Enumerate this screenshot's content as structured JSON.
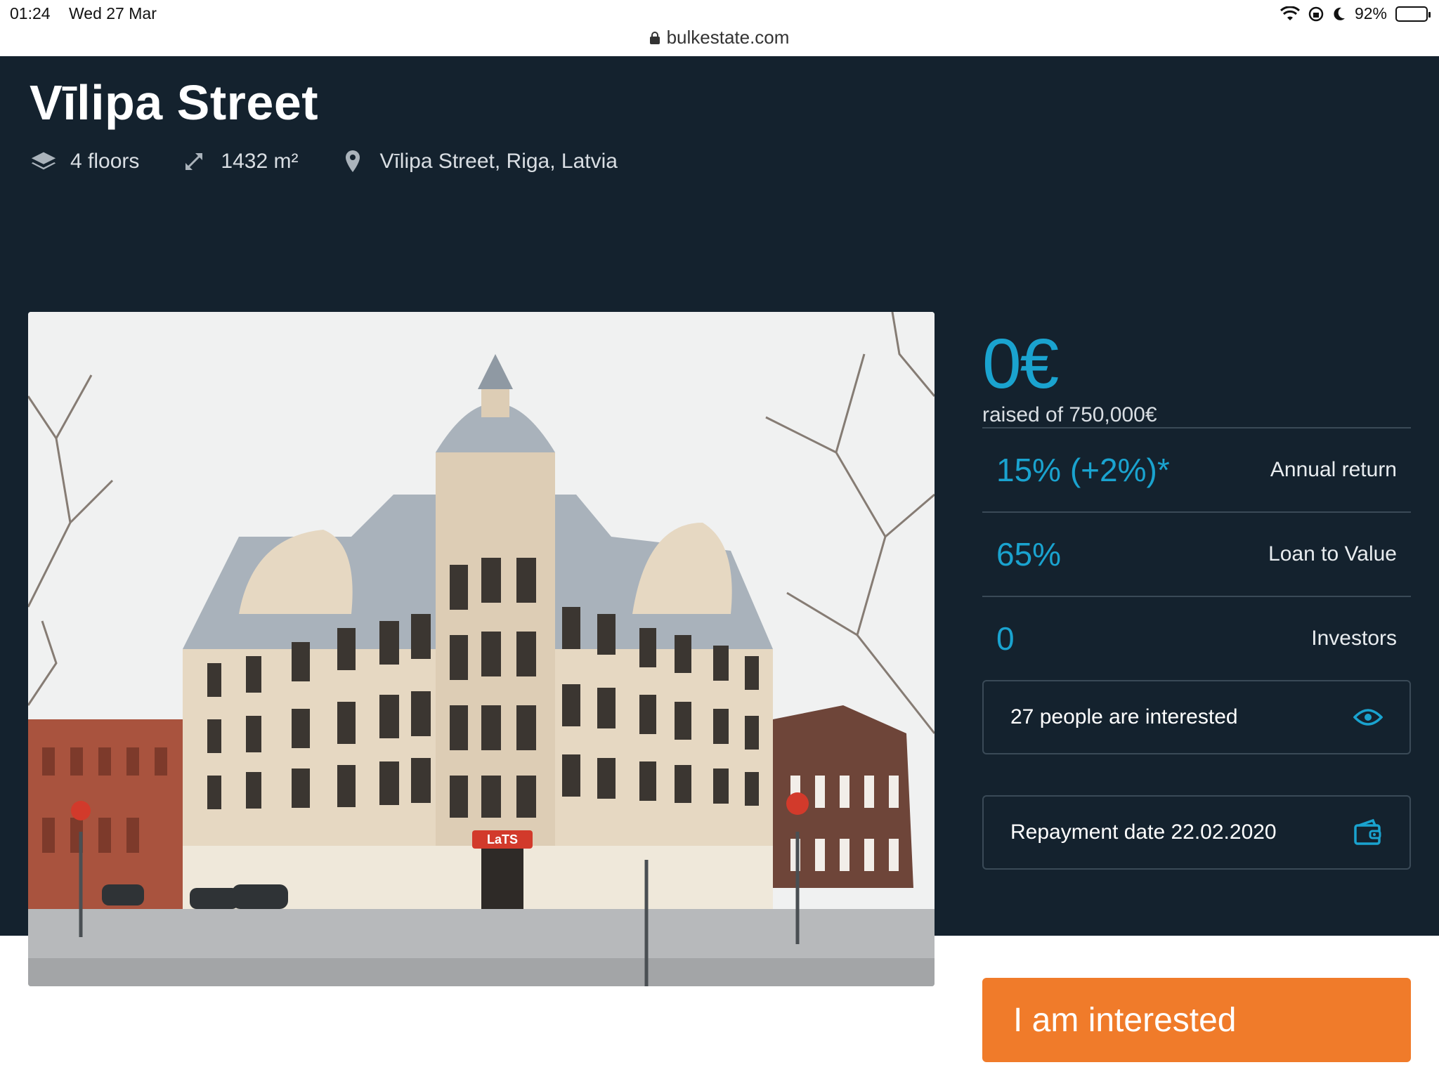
{
  "status_bar": {
    "time": "01:24",
    "date": "Wed 27 Mar",
    "battery": "92%",
    "battery_level": 0.92
  },
  "browser": {
    "url": "bulkestate.com"
  },
  "property": {
    "title": "Vīlipa Street",
    "floors": "4 floors",
    "area": "1432 m²",
    "location": "Vīlipa Street, Riga, Latvia"
  },
  "funding": {
    "raised": "0€",
    "raised_of": "raised of 750,000€"
  },
  "stats": [
    {
      "value": "15% (+2%)*",
      "label": "Annual return"
    },
    {
      "value": "65%",
      "label": "Loan to Value"
    },
    {
      "value": "0",
      "label": "Investors"
    }
  ],
  "interest": {
    "text": "27 people are interested"
  },
  "repayment": {
    "text": "Repayment date 22.02.2020"
  },
  "cta": {
    "label": "I am interested"
  },
  "photo": {
    "shop_sign": "LaTS"
  },
  "colors": {
    "hero_bg": "#14222e",
    "accent": "#1aa3cf",
    "cta": "#f07b2a"
  }
}
